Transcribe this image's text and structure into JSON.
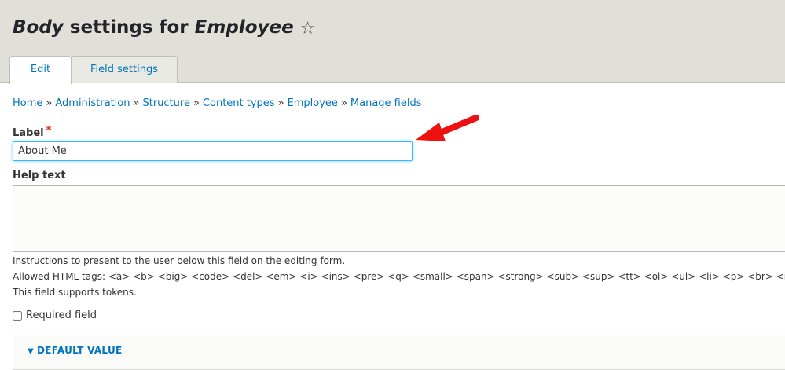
{
  "header": {
    "title_prefix": "Body",
    "title_middle": " settings for ",
    "title_suffix": "Employee",
    "favorite_icon": "star-outline-icon"
  },
  "tabs": [
    {
      "label": "Edit",
      "active": true
    },
    {
      "label": "Field settings",
      "active": false
    }
  ],
  "breadcrumb": {
    "items": [
      "Home",
      "Administration",
      "Structure",
      "Content types",
      "Employee",
      "Manage fields"
    ],
    "separator": "»"
  },
  "form": {
    "label_field": {
      "label": "Label",
      "required_marker": "*",
      "value": "About Me"
    },
    "help_text": {
      "label": "Help text",
      "value": ""
    },
    "descriptions": [
      "Instructions to present to the user below this field on the editing form.",
      "Allowed HTML tags: <a> <b> <big> <code> <del> <em> <i> <ins> <pre> <q> <small> <span> <strong> <sub> <sup> <tt> <ol> <ul> <li> <p> <br> <img>",
      "This field supports tokens."
    ],
    "required_field": {
      "label": "Required field",
      "checked": false
    },
    "default_value": {
      "summary": "Default value",
      "icon": "triangle-down-icon"
    }
  },
  "colors": {
    "link": "#0074bd",
    "header_bg": "#e0e0d8",
    "required": "#e32700",
    "annotation_arrow": "#ee1111",
    "focus_border": "#40b6ff"
  }
}
